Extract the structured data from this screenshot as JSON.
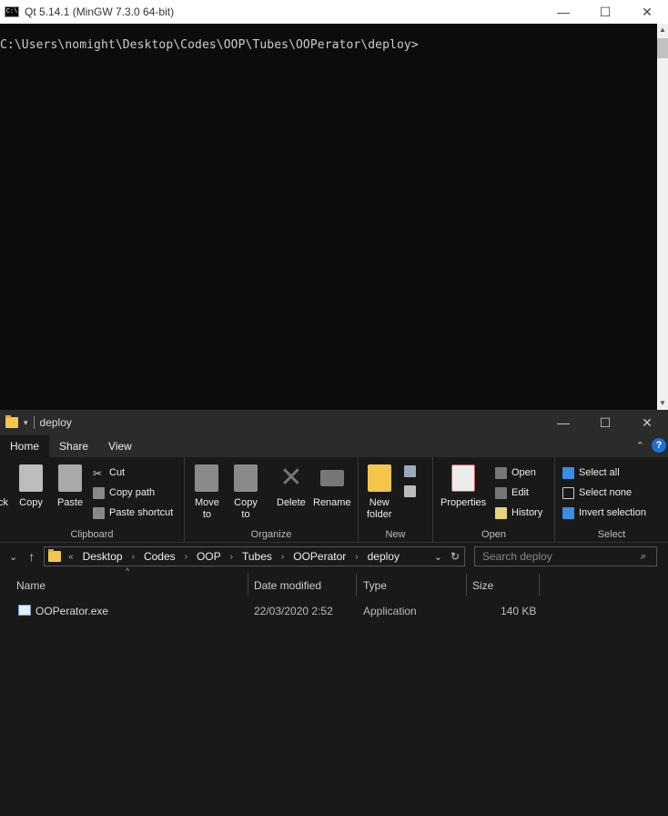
{
  "console": {
    "title": "Qt 5.14.1 (MinGW 7.3.0 64-bit)",
    "icon_label": "C:\\",
    "prompt": "C:\\Users\\nomight\\Desktop\\Codes\\OOP\\Tubes\\OOPerator\\deploy>",
    "minimize": "—",
    "maximize": "☐",
    "close": "✕"
  },
  "explorer": {
    "title": "deploy",
    "minimize": "—",
    "maximize": "☐",
    "close": "✕",
    "tabs": [
      "Home",
      "Share",
      "View"
    ],
    "ribbon": {
      "clipboard": {
        "label": "Clipboard",
        "pin_to_quick": "ck",
        "copy": "Copy",
        "paste": "Paste",
        "cut": "Cut",
        "copy_path": "Copy path",
        "paste_shortcut": "Paste shortcut"
      },
      "organize": {
        "label": "Organize",
        "move_to_1": "Move",
        "move_to_2": "to",
        "copy_to_1": "Copy",
        "copy_to_2": "to",
        "delete": "Delete",
        "rename": "Rename"
      },
      "new": {
        "label": "New",
        "new_folder_1": "New",
        "new_folder_2": "folder"
      },
      "open": {
        "label": "Open",
        "properties": "Properties",
        "open": "Open",
        "edit": "Edit",
        "history": "History"
      },
      "select": {
        "label": "Select",
        "select_all": "Select all",
        "select_none": "Select none",
        "invert_selection": "Invert selection"
      }
    },
    "breadcrumbs": [
      "Desktop",
      "Codes",
      "OOP",
      "Tubes",
      "OOPerator",
      "deploy"
    ],
    "search_placeholder": "Search deploy",
    "columns": {
      "name": "Name",
      "date": "Date modified",
      "type": "Type",
      "size": "Size"
    },
    "files": [
      {
        "name": "OOPerator.exe",
        "date": "22/03/2020 2:52",
        "type": "Application",
        "size": "140 KB"
      }
    ]
  },
  "colors": {
    "console_bg": "#0c0c0c",
    "explorer_bg": "#191919",
    "accent": "#1f6fd1",
    "folder": "#f3c64b"
  }
}
